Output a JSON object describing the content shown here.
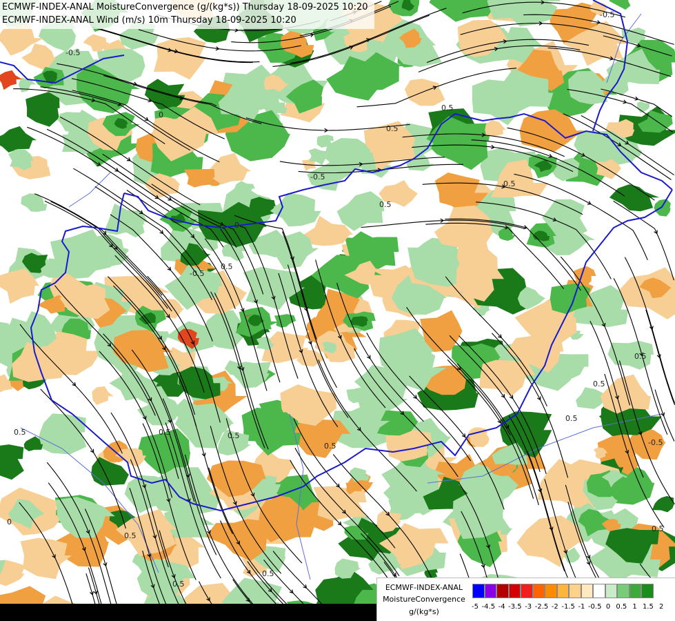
{
  "titles": {
    "line1": "ECMWF-INDEX-ANAL MoistureConvergence (g/(kg*s)) Thursday 18-09-2025 10:20",
    "line2": "ECMWF-INDEX-ANAL Wind (m/s) 10m Thursday 18-09-2025 10:20"
  },
  "legend": {
    "model": "ECMWF-INDEX-ANAL",
    "parameter": "MoistureConvergence",
    "unit": "g/(kg*s)",
    "ticks": [
      "-5",
      "-4.5",
      "-4",
      "-3.5",
      "-3",
      "-2.5",
      "-2",
      "-1.5",
      "-1",
      "-0.5",
      "0",
      "0.5",
      "1",
      "1.5",
      "2"
    ],
    "colors": [
      "#0000ff",
      "#8a00e6",
      "#b30000",
      "#d20000",
      "#f01e1e",
      "#ff6400",
      "#ff8c00",
      "#ffb43c",
      "#ffd28c",
      "#ffeac0",
      "#ffffff",
      "#c8ecc8",
      "#78cc78",
      "#3cab3c",
      "#1a8c1a"
    ]
  },
  "map_labels": [
    "0.5",
    "-0.5",
    "0",
    "0.5",
    "-0.5",
    "0.5",
    "0",
    "-0.5",
    "0.5",
    "0.5",
    "0.5",
    "0.5",
    "-0.5",
    "0.5",
    "0.5",
    "0.5",
    "0.5",
    "0.5",
    "0.5",
    "-0.5",
    "0.5",
    "0.5",
    "0",
    "0.5"
  ],
  "colors": {
    "border": "#1a1acd",
    "river": "#5a70d8",
    "streamline": "#000000",
    "dark_green": "#1a7a1a",
    "green": "#4cb84c",
    "light_green": "#a8dca8",
    "orange": "#f0a040",
    "light_orange": "#f7cf94",
    "red": "#e2461e"
  }
}
